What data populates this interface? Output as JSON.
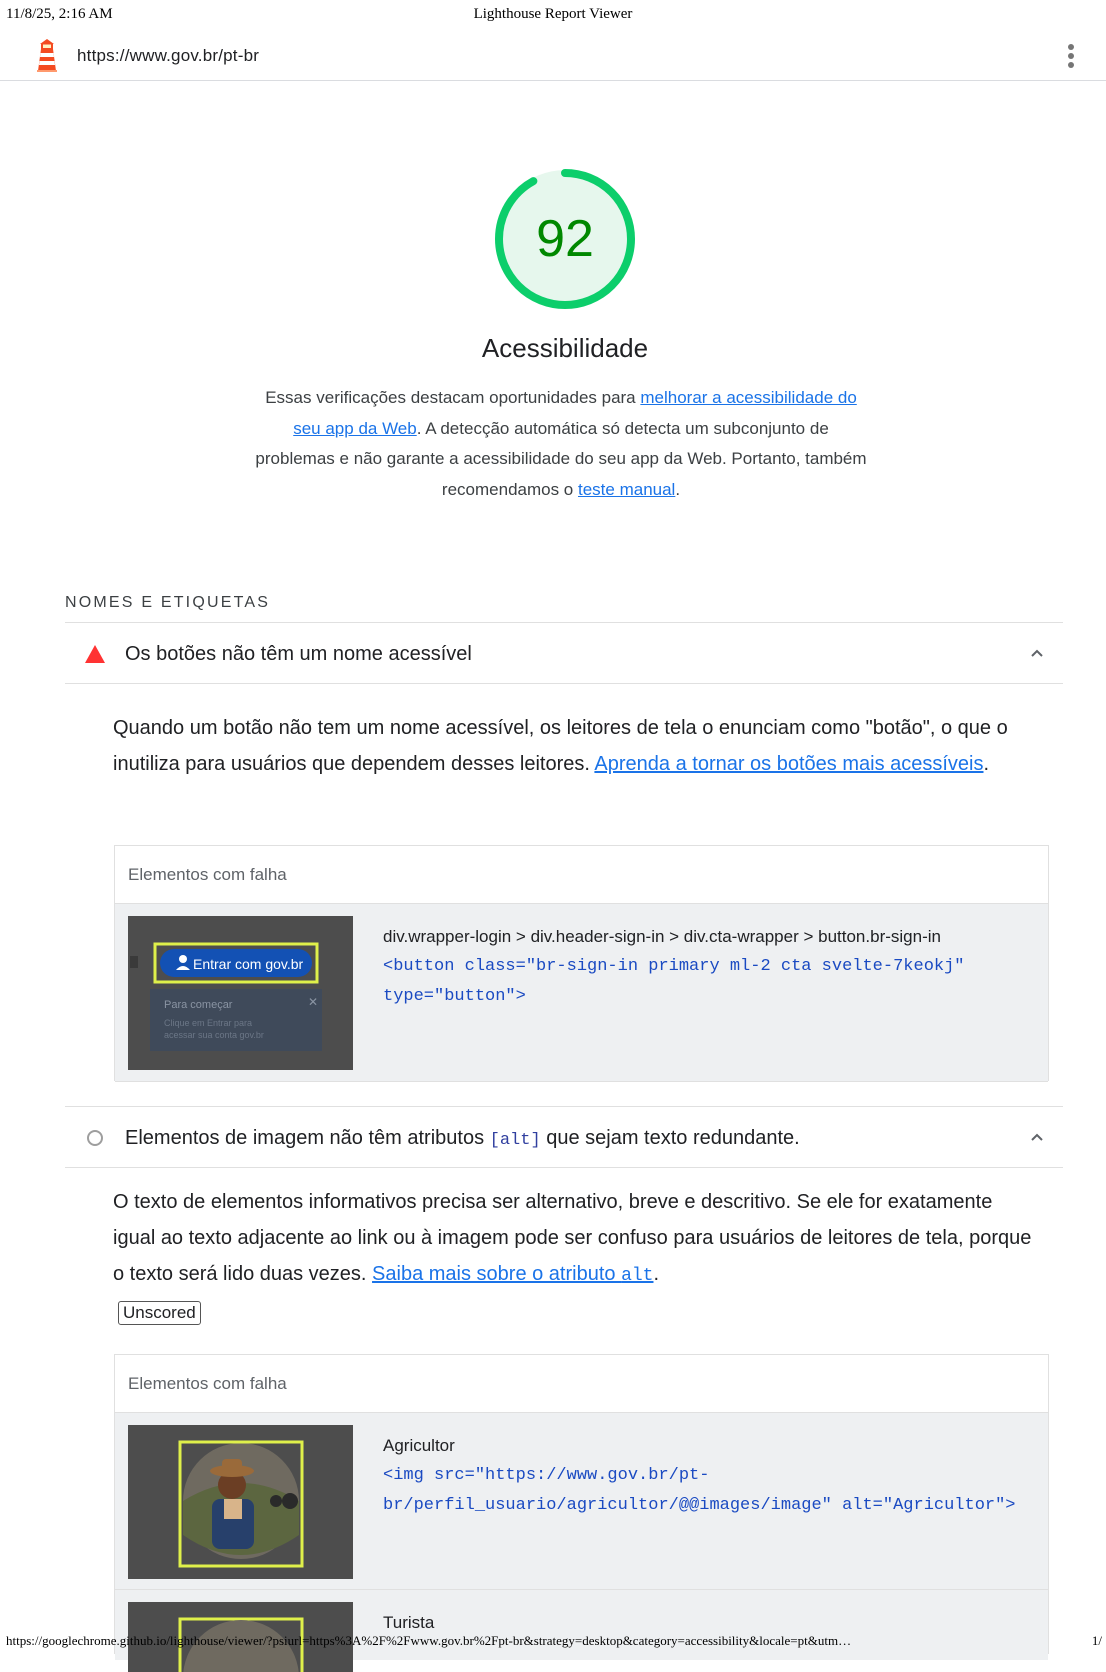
{
  "print_header": {
    "date": "11/8/25, 2:16 AM",
    "title": "Lighthouse Report Viewer"
  },
  "topbar": {
    "url": "https://www.gov.br/pt-br",
    "logo_icon": "lighthouse-icon",
    "menu_icon": "kebab-menu-icon"
  },
  "score": {
    "value": "92",
    "fraction": 0.92,
    "color": "#0cce6b"
  },
  "category": {
    "title": "Acessibilidade",
    "desc_part1": "Essas verificações destacam oportunidades para ",
    "desc_link1": "melhorar a acessibilidade do seu app da Web",
    "desc_part2": ". A detecção automática só detecta um subconjunto de problemas e não garante a acessibilidade do seu app da Web. Portanto, também recomendamos o ",
    "desc_link2": "teste manual",
    "desc_part3": "."
  },
  "group": {
    "title": "NOMES E ETIQUETAS"
  },
  "audits": [
    {
      "title": "Os botões não têm um nome acessível",
      "status": "fail",
      "desc_text": "Quando um botão não tem um nome acessível, os leitores de tela o enunciam como \"botão\", o que o inutiliza para usuários que dependem desses leitores. ",
      "desc_link": "Aprenda a tornar os botões mais acessíveis",
      "desc_end": ".",
      "details_header": "Elementos com falha",
      "items": [
        {
          "label": "div.wrapper-login > div.header-sign-in > div.cta-wrapper > button.br-sign-in",
          "snippet": "<button class=\"br-sign-in primary ml-2 cta svelte-7keokj\" type=\"button\">",
          "thumb": {
            "button_text": "Entrar com gov.br",
            "popup_title": "Para começar",
            "popup_text": "Clique em Entrar para acessar sua conta gov.br"
          }
        }
      ]
    },
    {
      "title_part1": "Elementos de imagem não têm atributos ",
      "title_code": "[alt]",
      "title_part2": " que sejam texto redundante.",
      "status": "informative",
      "desc_text": "O texto de elementos informativos precisa ser alternativo, breve e descritivo. Se ele for exatamente igual ao texto adjacente ao link ou à imagem pode ser confuso para usuários de leitores de tela, porque o texto será lido duas vezes. ",
      "desc_link": "Saiba mais sobre o atributo ",
      "desc_link_code": "alt",
      "desc_end": ".",
      "badge": "Unscored",
      "details_header": "Elementos com falha",
      "items": [
        {
          "label": "Agricultor",
          "snippet": "<img src=\"https://www.gov.br/pt-br/perfil_usuario/agricultor/@@images/image\" alt=\"Agricultor\">"
        },
        {
          "label": "Turista"
        }
      ]
    }
  ],
  "footer": {
    "url": "https://googlechrome.github.io/lighthouse/viewer/?psiurl=https%3A%2F%2Fwww.gov.br%2Fpt-br&strategy=desktop&category=accessibility&locale=pt&utm…",
    "page": "1/"
  }
}
